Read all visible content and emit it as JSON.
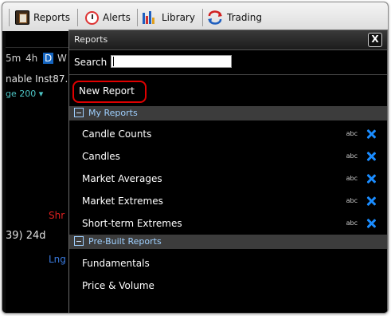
{
  "toolbar": {
    "reports": "Reports",
    "alerts": "Alerts",
    "library": "Library",
    "trading": "Trading"
  },
  "background": {
    "timeframes": [
      "5m",
      "4h",
      "D",
      "W"
    ],
    "selected_timeframe": "D",
    "row1": "nable  Inst87.",
    "row2": "ge 200 ▾",
    "shr": "Shr",
    "value": "39) 24d",
    "lng": "Lng"
  },
  "dialog": {
    "title": "Reports",
    "close": "X",
    "search_label": "Search",
    "search_value": "",
    "new_report": "New Report",
    "my_reports": {
      "title": "My Reports",
      "items": [
        "Candle Counts",
        "Candles",
        "Market Averages",
        "Market Extremes",
        "Short-term Extremes"
      ],
      "rename_label": "abc"
    },
    "prebuilt": {
      "title": "Pre-Built Reports",
      "items": [
        "Fundamentals",
        "Price & Volume"
      ]
    }
  },
  "colors": {
    "accent_red": "#e00000",
    "section_text": "#9fd0ff",
    "delete_blue": "#1a8cff"
  }
}
